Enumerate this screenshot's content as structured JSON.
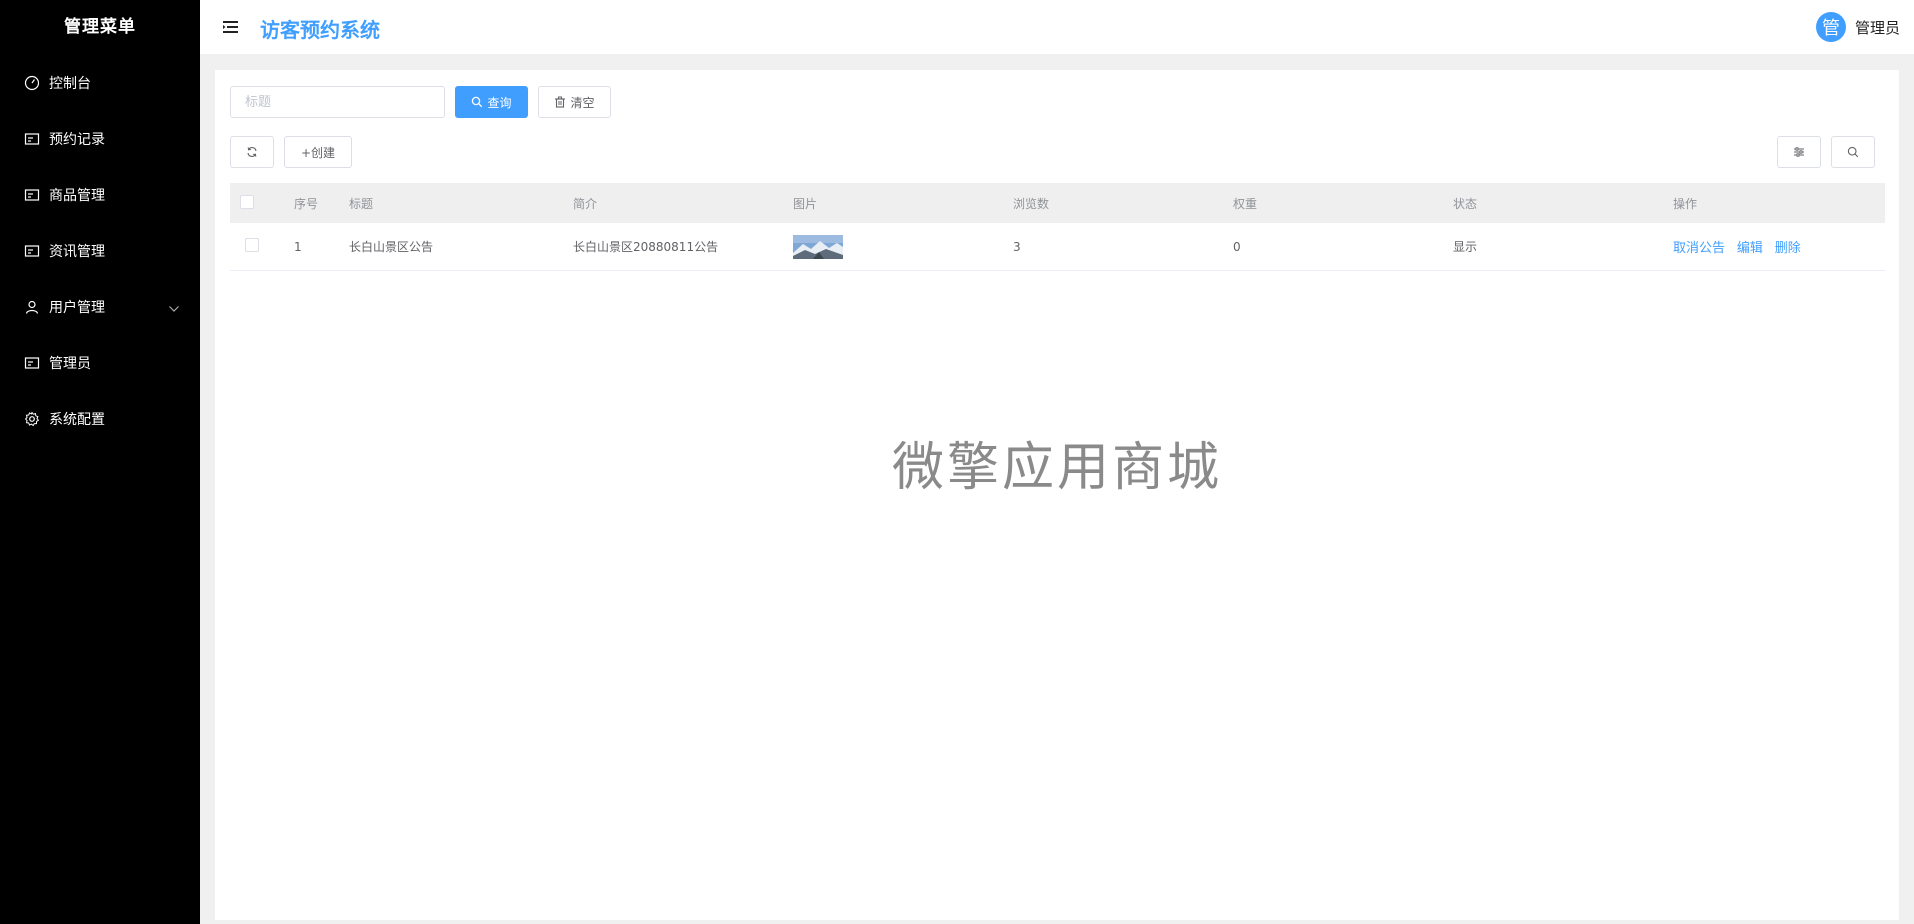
{
  "sidebar": {
    "title": "管理菜单",
    "items": [
      {
        "label": "控制台",
        "icon": "dashboard-icon"
      },
      {
        "label": "预约记录",
        "icon": "card-icon"
      },
      {
        "label": "商品管理",
        "icon": "card-icon"
      },
      {
        "label": "资讯管理",
        "icon": "card-icon"
      },
      {
        "label": "用户管理",
        "icon": "user-icon"
      },
      {
        "label": "管理员",
        "icon": "card-icon"
      },
      {
        "label": "系统配置",
        "icon": "gear-icon"
      }
    ]
  },
  "header": {
    "title": "访客预约系统",
    "avatar_text": "管",
    "user_name": "管理员"
  },
  "toolbar": {
    "search_placeholder": "标题",
    "query_label": "查询",
    "clear_label": "清空",
    "create_label": "+创建"
  },
  "table": {
    "columns": [
      "序号",
      "标题",
      "简介",
      "图片",
      "浏览数",
      "权重",
      "状态",
      "操作"
    ],
    "rows": [
      {
        "index": "1",
        "title": "长白山景区公告",
        "desc": "长白山景区20880811公告",
        "views": "3",
        "weight": "0",
        "status": "显示",
        "actions": [
          "取消公告",
          "编辑",
          "删除"
        ]
      }
    ]
  },
  "watermark": "微擎应用商城",
  "colors": {
    "primary": "#409eff",
    "sidebar_bg": "#000000"
  }
}
